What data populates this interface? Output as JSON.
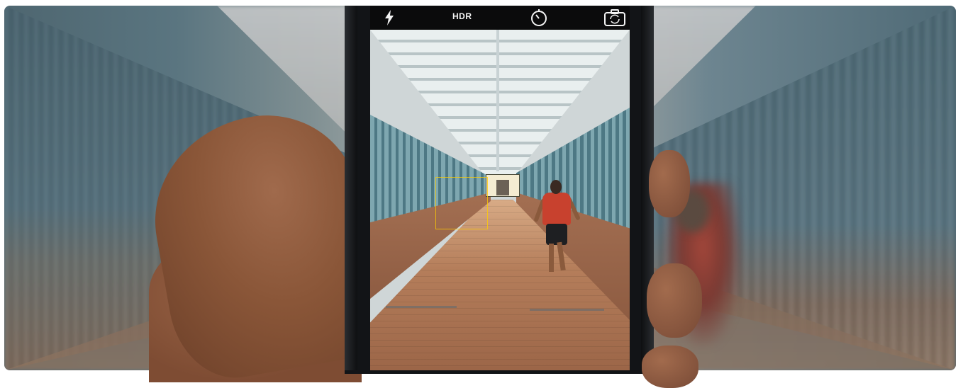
{
  "camera_ui": {
    "flash_icon": "lightning-bolt",
    "hdr_label": "HDR",
    "timer_icon": "timer",
    "flip_icon": "camera-flip"
  }
}
